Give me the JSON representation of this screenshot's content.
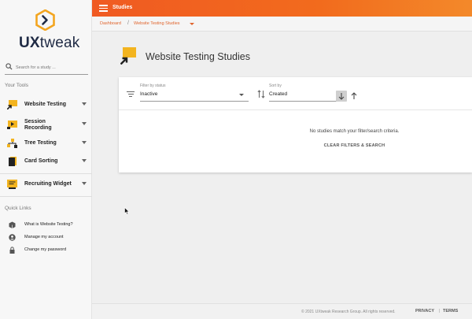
{
  "brand": {
    "logo_bold": "UX",
    "logo_light": "tweak",
    "accent": "#f05a22"
  },
  "search": {
    "placeholder": "Search for a study ..."
  },
  "sidebar": {
    "tools_heading": "Your Tools",
    "items": [
      {
        "label": "Website Testing",
        "icon": "website-testing-icon"
      },
      {
        "label": "Session Recording",
        "icon": "session-recording-icon"
      },
      {
        "label": "Tree Testing",
        "icon": "tree-testing-icon"
      },
      {
        "label": "Card Sorting",
        "icon": "card-sorting-icon"
      },
      {
        "label": "Recruiting Widget",
        "icon": "recruiting-widget-icon"
      }
    ],
    "quick_heading": "Quick Links",
    "quick_links": [
      {
        "label": "What is Website Testing?",
        "icon": "box-icon"
      },
      {
        "label": "Manage my account",
        "icon": "account-icon"
      },
      {
        "label": "Change my password",
        "icon": "lock-icon"
      }
    ]
  },
  "header": {
    "title": "Studies"
  },
  "breadcrumb": {
    "home": "Dashboard",
    "separator": "/",
    "current": "Website Testing Studies"
  },
  "page": {
    "title": "Website Testing Studies"
  },
  "filters": {
    "status_label": "Filter by status",
    "status_value": "Inactive",
    "sort_label": "Sort by",
    "sort_value": "Created"
  },
  "results": {
    "empty_message": "No studies match your filter/search criteria.",
    "clear_button": "CLEAR FILTERS & SEARCH"
  },
  "footer": {
    "copyright": "© 2021 UXtweak Research Group. All rights reserved.",
    "privacy": "PRIVACY",
    "separator": "|",
    "terms": "TERMS"
  }
}
